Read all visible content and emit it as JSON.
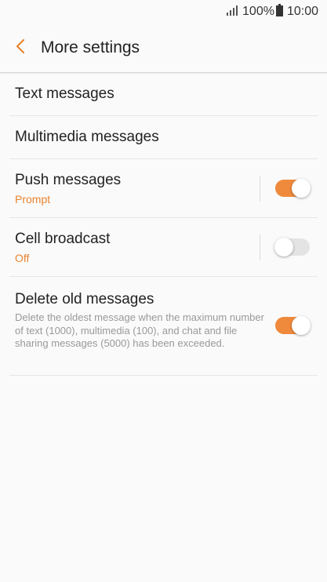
{
  "status_bar": {
    "battery_percent": "100%",
    "time": "10:00"
  },
  "header": {
    "title": "More settings"
  },
  "settings": {
    "text_messages": {
      "label": "Text messages"
    },
    "multimedia_messages": {
      "label": "Multimedia messages"
    },
    "push_messages": {
      "label": "Push messages",
      "sub": "Prompt",
      "enabled": true
    },
    "cell_broadcast": {
      "label": "Cell broadcast",
      "sub": "Off",
      "enabled": false
    },
    "delete_old_messages": {
      "label": "Delete old messages",
      "description": "Delete the oldest message when the maximum number of text (1000), multimedia (100), and chat and file sharing messages (5000) has been exceeded.",
      "enabled": true
    }
  },
  "colors": {
    "accent": "#ef8a3c",
    "subtext_accent": "#e8842f",
    "toggle_off": "#e4e4e4"
  }
}
